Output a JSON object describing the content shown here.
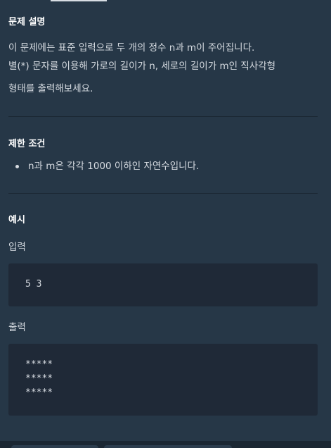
{
  "problem": {
    "title": "문제 설명",
    "lines": [
      "이 문제에는 표준 입력으로 두 개의 정수 n과 m이 주어집니다.",
      "별(*) 문자를 이용해 가로의 길이가 n, 세로의 길이가 m인 직사각형",
      "형태를 출력해보세요."
    ]
  },
  "constraints": {
    "title": "제한 조건",
    "items": [
      "n과 m은 각각 1000 이하인 자연수입니다."
    ]
  },
  "example": {
    "title": "예시",
    "input_label": "입력",
    "input_lines": [
      "5 3"
    ],
    "output_label": "출력",
    "output_lines": [
      "*****",
      "*****",
      "*****"
    ]
  }
}
